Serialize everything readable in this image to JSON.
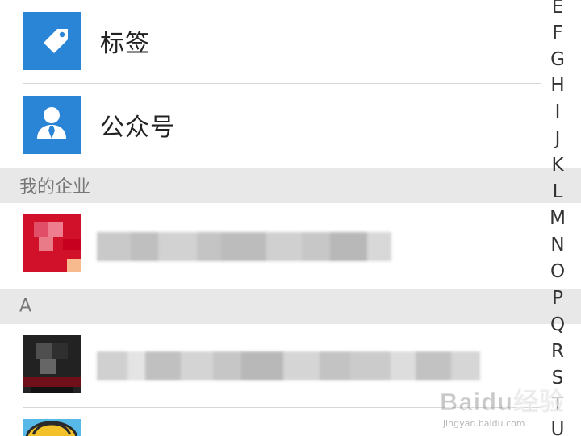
{
  "contacts": {
    "tags_label": "标签",
    "public_accounts_label": "公众号"
  },
  "sections": {
    "my_company": "我的企业",
    "a": "A"
  },
  "index_bar": {
    "letters": [
      "E",
      "F",
      "G",
      "H",
      "I",
      "J",
      "K",
      "L",
      "M",
      "N",
      "O",
      "P",
      "Q",
      "R",
      "S",
      "T",
      "U"
    ]
  },
  "icons": {
    "tag": "tag-icon",
    "public_account": "person-tie-icon",
    "blurred_company": "blurred-avatar",
    "blurred_contact": "blurred-avatar",
    "partial_contact": "avatar-icon"
  },
  "watermark": {
    "logo_text": "Baidu经验",
    "url_text": "jingyan.baidu.com"
  },
  "colors": {
    "accent_blue": "#2b85d6",
    "section_bg": "#e8e8e8",
    "divider": "#d6d6d6"
  }
}
